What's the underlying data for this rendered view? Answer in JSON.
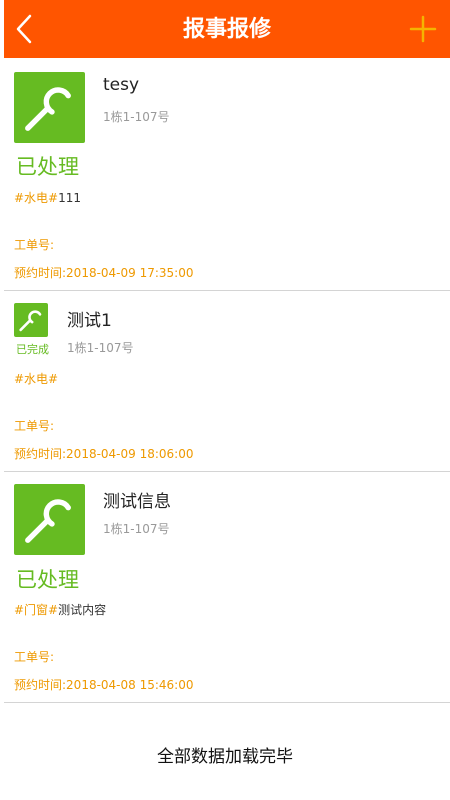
{
  "header": {
    "title": "报事报修",
    "back_icon": "chevron-left-icon",
    "add_icon": "plus-icon",
    "background": "#ff5500"
  },
  "items": [
    {
      "title": "tesy",
      "address": "1栋1-107号",
      "status": "已处理",
      "tag": "#水电#",
      "content": "111",
      "order_label": "工单号:",
      "order_no": "",
      "appointment_label": "预约时间:",
      "appointment_time": "2018-04-09 17:35:00",
      "icon": "wrench-icon"
    },
    {
      "title": "测试1",
      "address": "1栋1-107号",
      "status": "已完成",
      "tag": "#水电#",
      "content": "",
      "order_label": "工单号:",
      "order_no": "",
      "appointment_label": "预约时间:",
      "appointment_time": "2018-04-09 18:06:00",
      "icon": "wrench-icon"
    },
    {
      "title": "测试信息",
      "address": "1栋1-107号",
      "status": "已处理",
      "tag": "#门窗#",
      "content": "测试内容",
      "order_label": "工单号:",
      "order_no": "",
      "appointment_label": "预约时间:",
      "appointment_time": "2018-04-08 15:46:00",
      "icon": "wrench-icon"
    }
  ],
  "footer": {
    "text": "全部数据加载完毕"
  },
  "colors": {
    "accent": "#ff5500",
    "status_green": "#66bb22",
    "tag_orange": "#ee9900"
  }
}
